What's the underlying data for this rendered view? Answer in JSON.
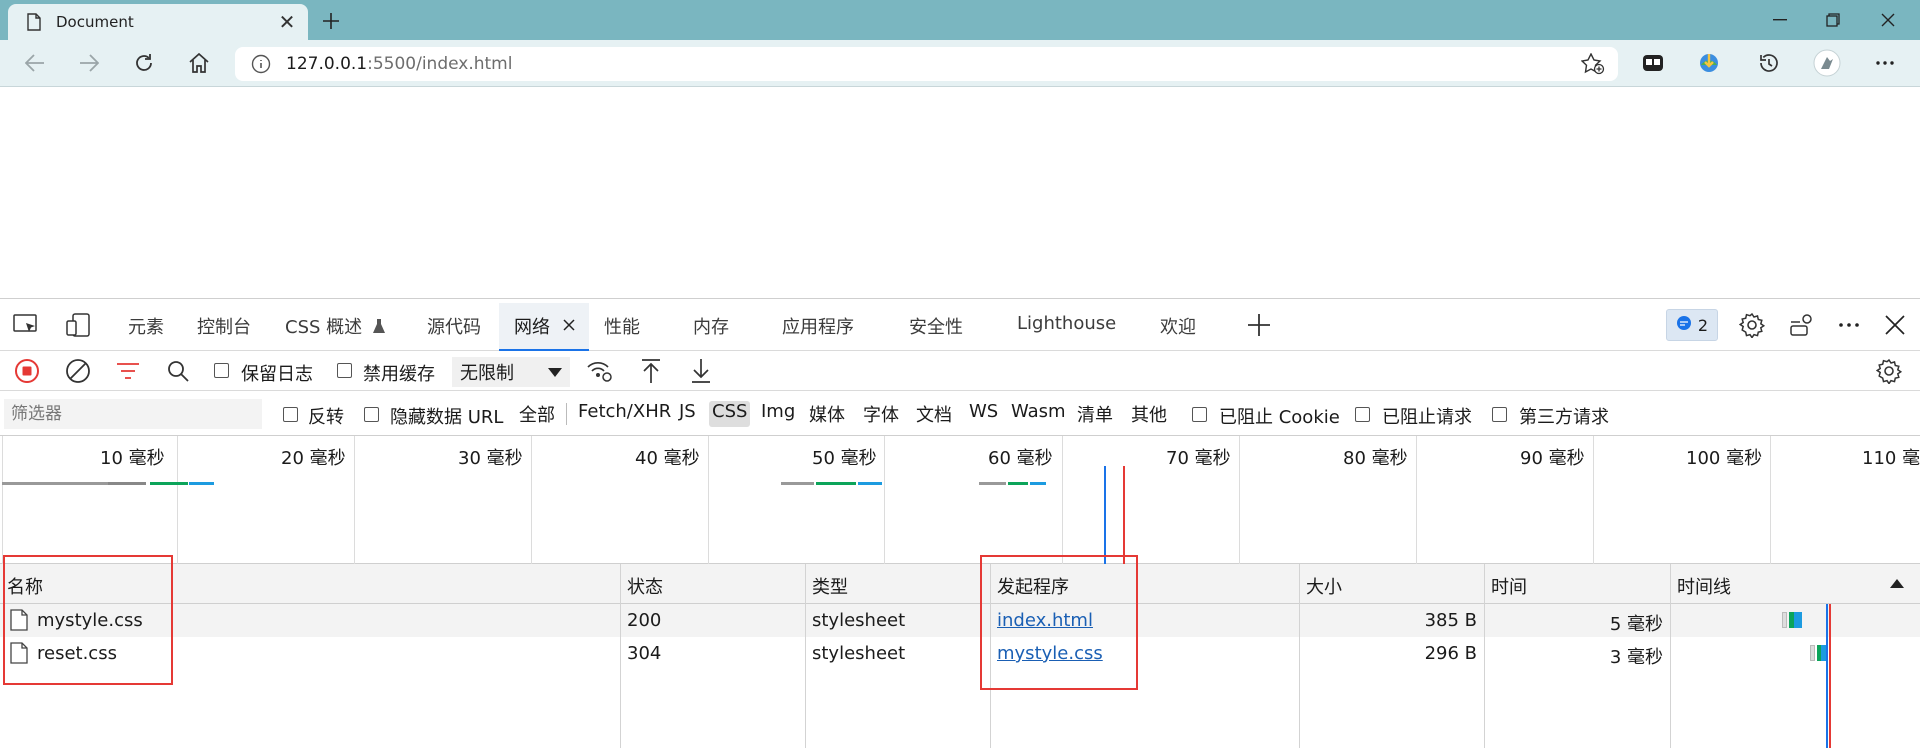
{
  "browser": {
    "tab_title": "Document",
    "url_host": "127.0.0.1",
    "url_rest": ":5500/index.html"
  },
  "devtools": {
    "tabs": [
      "元素",
      "控制台",
      "CSS 概述",
      "源代码",
      "网络",
      "性能",
      "内存",
      "应用程序",
      "安全性",
      "Lighthouse",
      "欢迎"
    ],
    "active_tab": "网络",
    "issues_count": "2",
    "network": {
      "preserve_log": "保留日志",
      "disable_cache": "禁用缓存",
      "throttle": "无限制",
      "filter_placeholder": "筛选器",
      "invert": "反转",
      "hide_data_urls": "隐藏数据 URL",
      "type_filters": [
        "全部",
        "Fetch/XHR",
        "JS",
        "CSS",
        "Img",
        "媒体",
        "字体",
        "文档",
        "WS",
        "Wasm",
        "清单",
        "其他"
      ],
      "selected_type": "CSS",
      "blocked_cookies": "已阻止 Cookie",
      "blocked_requests": "已阻止请求",
      "third_party": "第三方请求",
      "overview_ticks": [
        "10 毫秒",
        "20 毫秒",
        "30 毫秒",
        "40 毫秒",
        "50 毫秒",
        "60 毫秒",
        "70 毫秒",
        "80 毫秒",
        "90 毫秒",
        "100 毫秒",
        "110 毫"
      ],
      "columns": [
        "名称",
        "状态",
        "类型",
        "发起程序",
        "大小",
        "时间",
        "时间线"
      ],
      "requests": [
        {
          "name": "mystyle.css",
          "status": "200",
          "type": "stylesheet",
          "initiator": "index.html",
          "size": "385 B",
          "time": "5 毫秒"
        },
        {
          "name": "reset.css",
          "status": "304",
          "type": "stylesheet",
          "initiator": "mystyle.css",
          "size": "296 B",
          "time": "3 毫秒"
        }
      ]
    }
  },
  "colors": {
    "titlebar": "#7ab6c0",
    "toolbar": "#e6f1f3",
    "highlight_box": "#e53935",
    "link": "#1a5fb4",
    "record_red": "#e53935"
  }
}
